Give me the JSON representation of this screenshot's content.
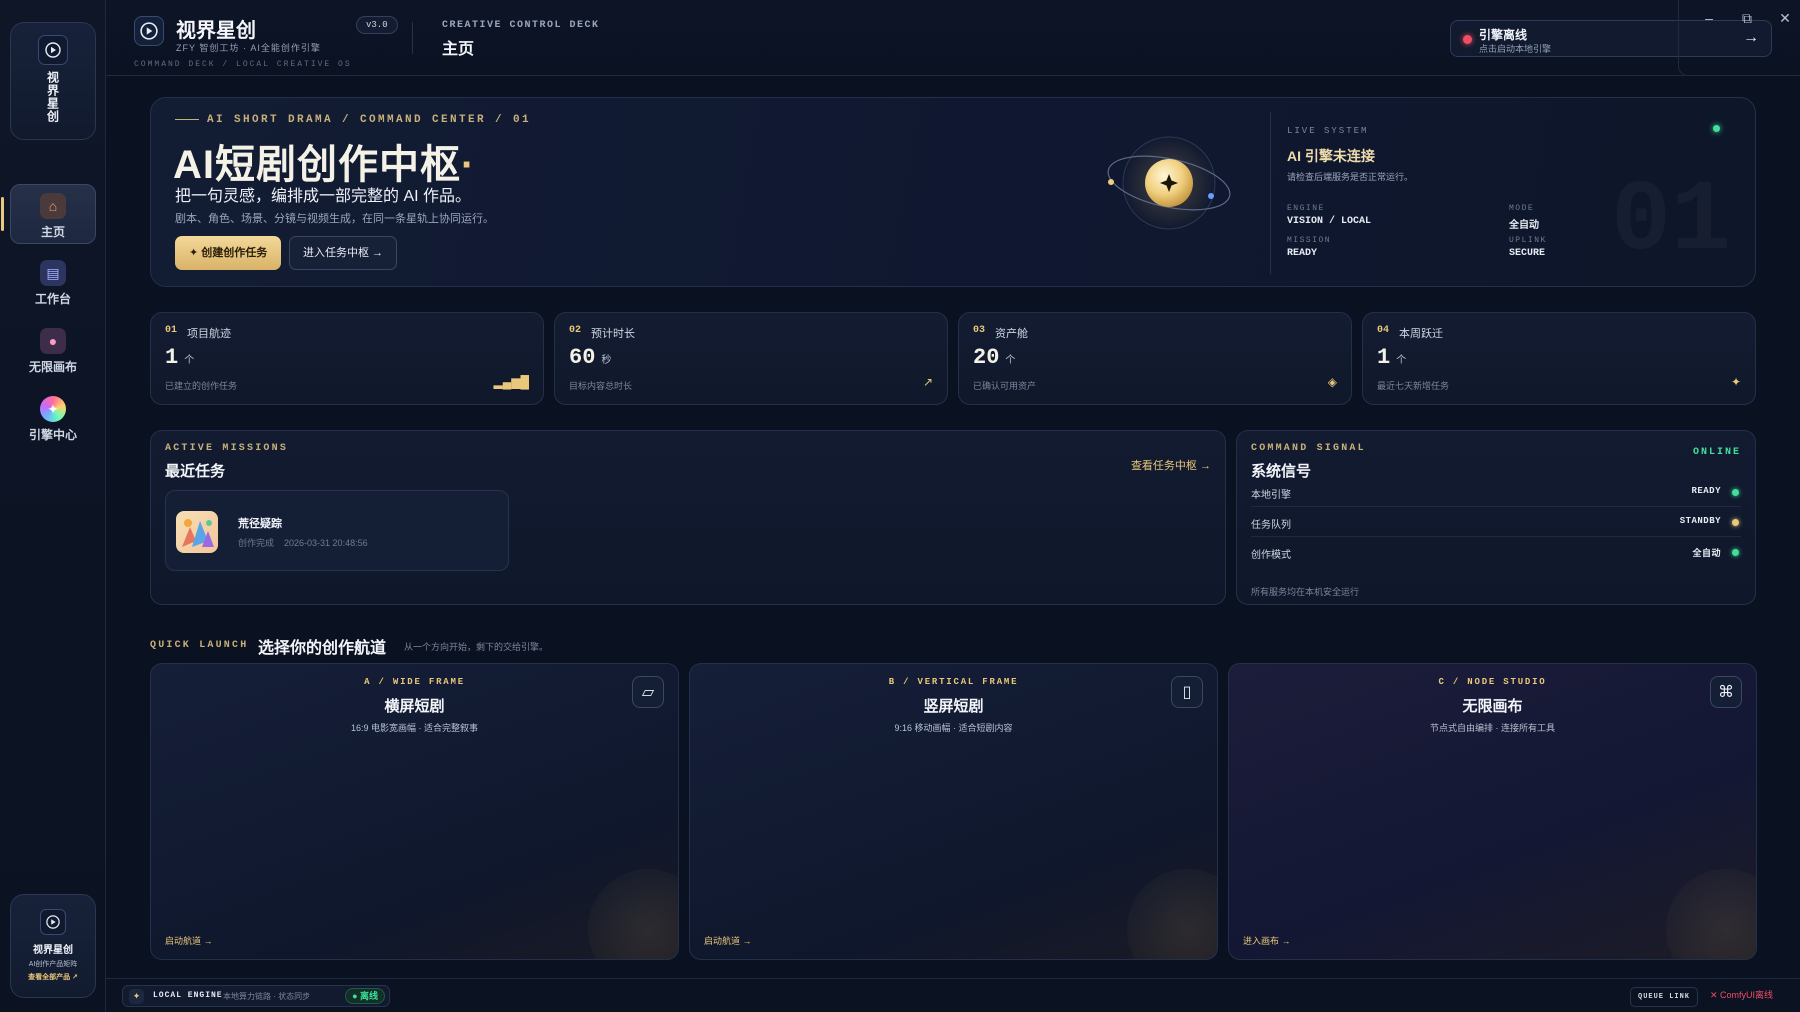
{
  "sidebar": {
    "brand_vertical": "视界星创",
    "items": [
      {
        "label": "主页",
        "icon": "home-icon",
        "active": true
      },
      {
        "label": "工作台",
        "icon": "clapperboard-icon",
        "active": false
      },
      {
        "label": "无限画布",
        "icon": "palette-icon",
        "active": false
      },
      {
        "label": "引擎中心",
        "icon": "engine-icon",
        "active": false
      }
    ],
    "promo": {
      "title": "视界星创",
      "subtitle": "AI创作产品矩阵",
      "link": "查看全部产品 ↗"
    }
  },
  "topbar": {
    "app_name": "视界星创",
    "app_sub": "ZFY 智创工坊 · AI全能创作引擎",
    "version": "v3.0",
    "path": "COMMAND DECK / LOCAL CREATIVE OS",
    "deck_label": "CREATIVE CONTROL DECK",
    "deck_title": "主页",
    "engine_status": {
      "title": "引擎离线",
      "subtitle": "点击启动本地引擎",
      "arrow": "→",
      "color": "#ef4e62"
    },
    "window_controls": {
      "minimize": "–",
      "maximize": "⧉",
      "close": "✕"
    }
  },
  "hero": {
    "kicker": "AI SHORT DRAMA / COMMAND CENTER / 01",
    "title": "AI短剧创作中枢",
    "title_dot": "·",
    "subtitle": "把一句灵感，编排成一部完整的 AI 作品。",
    "description": "剧本、角色、场景、分镜与视频生成，在同一条星轨上协同运行。",
    "primary_button": "✦ 创建创作任务",
    "secondary_button": "进入任务中枢 →",
    "live": {
      "label": "LIVE SYSTEM",
      "title": "AI 引擎未连接",
      "description": "请检查后端服务是否正常运行。",
      "engine_key": "ENGINE",
      "engine_val": "VISION / LOCAL",
      "mode_key": "MODE",
      "mode_val": "全自动",
      "mission_key": "MISSION",
      "mission_val": "READY",
      "uplink_key": "UPLINK",
      "uplink_val": "SECURE",
      "big_number": "01"
    }
  },
  "stats": [
    {
      "num": "01",
      "label": "项目航迹",
      "value": "1",
      "unit": "个",
      "desc": "已建立的创作任务",
      "icon": "bar-chart-icon",
      "glyph": "▂▄▆█"
    },
    {
      "num": "02",
      "label": "预计时长",
      "value": "60",
      "unit": "秒",
      "desc": "目标内容总时长",
      "icon": "trend-arrow-icon",
      "glyph": "↗"
    },
    {
      "num": "03",
      "label": "资产舱",
      "value": "20",
      "unit": "个",
      "desc": "已确认可用资产",
      "icon": "diamond-icon",
      "glyph": "◈"
    },
    {
      "num": "04",
      "label": "本周跃迁",
      "value": "1",
      "unit": "个",
      "desc": "最近七天新增任务",
      "icon": "sparkle-icon",
      "glyph": "✦"
    }
  ],
  "missions": {
    "kicker": "ACTIVE MISSIONS",
    "title": "最近任务",
    "link": "查看任务中枢 →",
    "items": [
      {
        "name": "荒径疑踪",
        "status": "创作完成",
        "time": "2026-03-31 20:48:56"
      }
    ]
  },
  "signal": {
    "kicker": "COMMAND SIGNAL",
    "title": "系统信号",
    "online": "ONLINE",
    "rows": [
      {
        "key": "本地引擎",
        "value": "READY",
        "color": "#3ee09a"
      },
      {
        "key": "任务队列",
        "value": "STANDBY",
        "color": "#e9c77b"
      },
      {
        "key": "创作模式",
        "value": "全自动",
        "color": "#3ee09a"
      }
    ],
    "footer": "所有服务均在本机安全运行"
  },
  "quick_launch": {
    "kicker": "QUICK LAUNCH",
    "title": "选择你的创作航道",
    "subtitle": "从一个方向开始，剩下的交给引擎。",
    "cards": [
      {
        "kicker": "A / WIDE FRAME",
        "title": "横屏短剧",
        "desc": "16:9 电影宽画幅 · 适合完整叙事",
        "action": "启动航道 →",
        "icon": "landscape-frame-icon",
        "glyph": "▱"
      },
      {
        "kicker": "B / VERTICAL FRAME",
        "title": "竖屏短剧",
        "desc": "9:16 移动画幅 · 适合短剧内容",
        "action": "启动航道 →",
        "icon": "portrait-frame-icon",
        "glyph": "▯"
      },
      {
        "kicker": "C / NODE STUDIO",
        "title": "无限画布",
        "desc": "节点式自由编排 · 连接所有工具",
        "action": "进入画布 →",
        "icon": "command-key-icon",
        "glyph": "⌘"
      }
    ]
  },
  "statusbar": {
    "engine_label": "LOCAL ENGINE",
    "engine_desc": "本地算力链路 · 状态同步",
    "engine_chip": "● 离线",
    "queue": "QUEUE LINK",
    "comfy": "✕ ComfyUI离线"
  }
}
